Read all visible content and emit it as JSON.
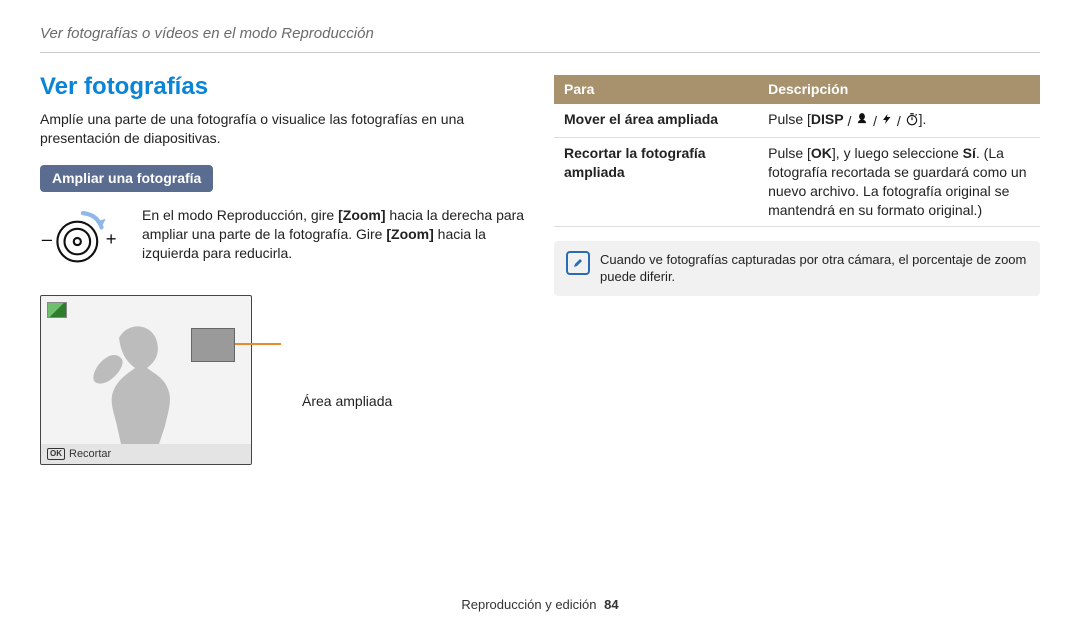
{
  "breadcrumb": "Ver fotografías o vídeos en el modo Reproducción",
  "left": {
    "title": "Ver fotografías",
    "intro": "Amplíe una parte de una fotografía o visualice las fotografías en una presentación de diapositivas.",
    "pill": "Ampliar una fotografía",
    "zoom_text_pre": "En el modo Reproducción, gire ",
    "zoom_b1": "[Zoom]",
    "zoom_text_mid": " hacia la derecha para ampliar una parte de la fotografía. Gire ",
    "zoom_b2": "[Zoom]",
    "zoom_text_post": " hacia la izquierda para reducirla.",
    "preview_footer_label": "Recortar",
    "leader_label": "Área ampliada"
  },
  "right": {
    "headers": {
      "para": "Para",
      "desc": "Descripción"
    },
    "rows": [
      {
        "para": "Mover el área ampliada",
        "desc_pre": "Pulse [",
        "disp": "DISP",
        "desc_post": "]."
      },
      {
        "para": "Recortar la fotografía ampliada",
        "desc_pre": "Pulse [",
        "ok": "OK",
        "desc_mid": "], y luego seleccione ",
        "si": "Sí",
        "desc_tail": ". (La fotografía recortada se guardará como un nuevo archivo. La fotografía original se mantendrá en su formato original.)"
      }
    ],
    "note": "Cuando ve fotografías capturadas por otra cámara, el porcentaje de zoom puede diferir."
  },
  "footer": {
    "text": "Reproducción y edición",
    "page": "84"
  }
}
